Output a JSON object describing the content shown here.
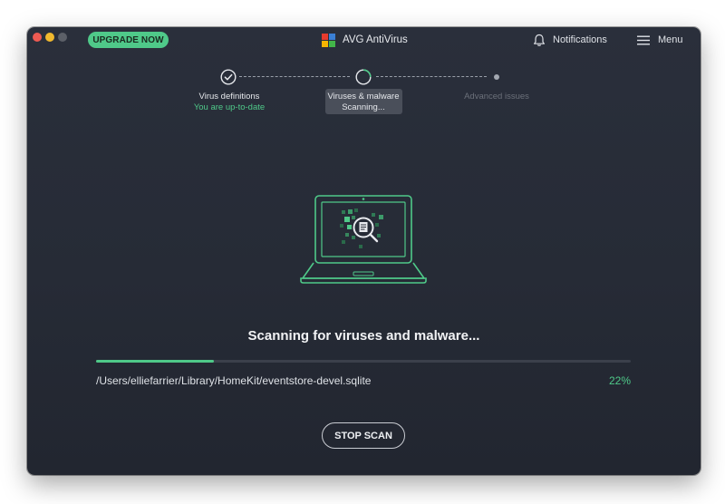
{
  "window": {
    "app_title": "AVG AntiVirus",
    "upgrade_label": "UPGRADE NOW",
    "notifications_label": "Notifications",
    "menu_label": "Menu"
  },
  "steps": [
    {
      "title": "Virus definitions",
      "status": "You are up-to-date",
      "state": "done"
    },
    {
      "title": "Viruses & malware",
      "status": "Scanning...",
      "state": "active"
    },
    {
      "title": "Advanced issues",
      "status": "",
      "state": "pending"
    }
  ],
  "scan": {
    "heading": "Scanning for viruses and malware...",
    "progress_percent": 22,
    "progress_label": "22%",
    "current_file": "/Users/elliefarrier/Library/HomeKit/eventstore-devel.sqlite",
    "stop_label": "STOP SCAN"
  },
  "colors": {
    "accent": "#4fc989",
    "background": "#262b36",
    "text": "#e6e8ec",
    "muted": "#6b707a"
  },
  "icons": {
    "logo": "avg-logo-icon",
    "notifications": "bell-icon",
    "menu": "hamburger-icon",
    "illustration": "laptop-scan-icon"
  }
}
